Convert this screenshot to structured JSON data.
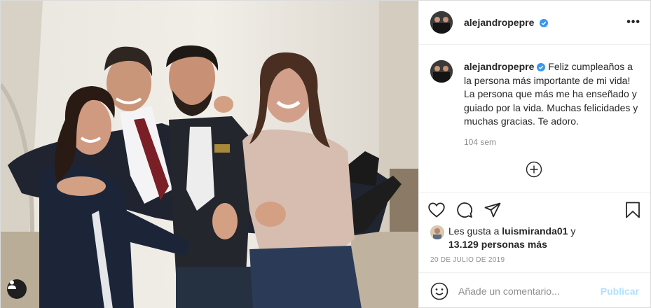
{
  "post": {
    "username": "alejandropepre",
    "verified": true,
    "caption": "Feliz cumpleaños a la persona más importante de mi vida! La persona que más me ha enseñado y guiado por la vida. Muchas felicidades y muchas gracias. Te adoro.",
    "time_ago": "104 sem",
    "date": "20 DE JULIO DE 2019"
  },
  "likes": {
    "prefix": "Les gusta a ",
    "liker": "luismiranda01",
    "connector": " y",
    "others": "13.129 personas más"
  },
  "comment": {
    "placeholder": "Añade un comentario...",
    "publish_label": "Publicar"
  },
  "colors": {
    "verified": "#3897f0",
    "publish_disabled": "#b2dffc",
    "muted_text": "#8e8e8e",
    "border": "#dbdbdb"
  },
  "icons": [
    "more-options-icon",
    "verified-badge-icon",
    "load-more-comments-icon",
    "heart-icon",
    "comment-icon",
    "share-icon",
    "bookmark-icon",
    "emoji-icon",
    "user-tag-icon"
  ]
}
